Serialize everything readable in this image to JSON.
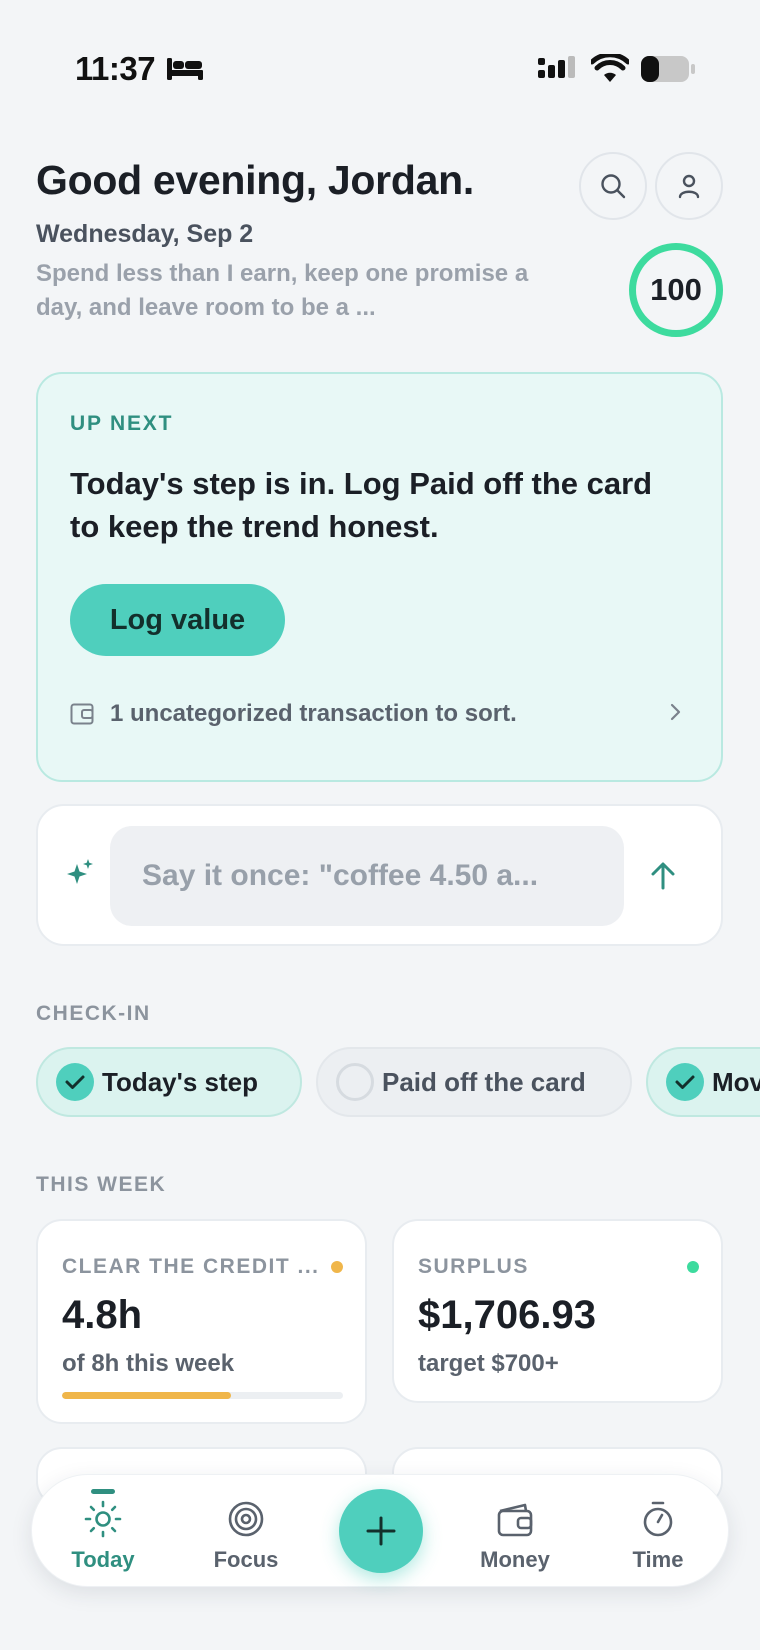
{
  "status_bar": {
    "time": "11:37"
  },
  "header": {
    "greeting": "Good evening, Jordan.",
    "date": "Wednesday, Sep 2",
    "mission": "Spend less than I earn, keep one promise a day, and leave room to be a ...",
    "score": "100"
  },
  "up_next": {
    "eyebrow": "UP NEXT",
    "headline": "Today's step is in. Log Paid off the card to keep the trend honest.",
    "button_label": "Log value",
    "transaction_notice": "1 uncategorized transaction to sort."
  },
  "capture": {
    "placeholder": "Say it once: \"coffee 4.50 a..."
  },
  "checkin": {
    "label": "CHECK-IN",
    "chips": [
      {
        "label": "Today's step",
        "done": true
      },
      {
        "label": "Paid off the card",
        "done": false
      },
      {
        "label": "Mov",
        "done": true
      }
    ]
  },
  "this_week": {
    "label": "THIS WEEK",
    "cards": [
      {
        "label": "CLEAR THE CREDIT ...",
        "value": "4.8h",
        "sub": "of 8h this week",
        "progress": 0.6,
        "dot_color": "#f0b64a"
      },
      {
        "label": "SURPLUS",
        "value": "$1,706.93",
        "sub": "target $700+",
        "dot_color": "#3ddb9e"
      }
    ]
  },
  "tabbar": {
    "tabs": [
      {
        "label": "Today",
        "icon": "sun-icon",
        "active": true
      },
      {
        "label": "Focus",
        "icon": "target-icon",
        "active": false
      },
      {
        "label": "Money",
        "icon": "wallet-icon",
        "active": false
      },
      {
        "label": "Time",
        "icon": "stopwatch-icon",
        "active": false
      }
    ],
    "fab_icon": "plus-icon"
  },
  "colors": {
    "accent": "#4fcfbd",
    "accent_dark": "#2f8f80",
    "score_ring": "#3ddb9e",
    "warning": "#f0b64a"
  }
}
